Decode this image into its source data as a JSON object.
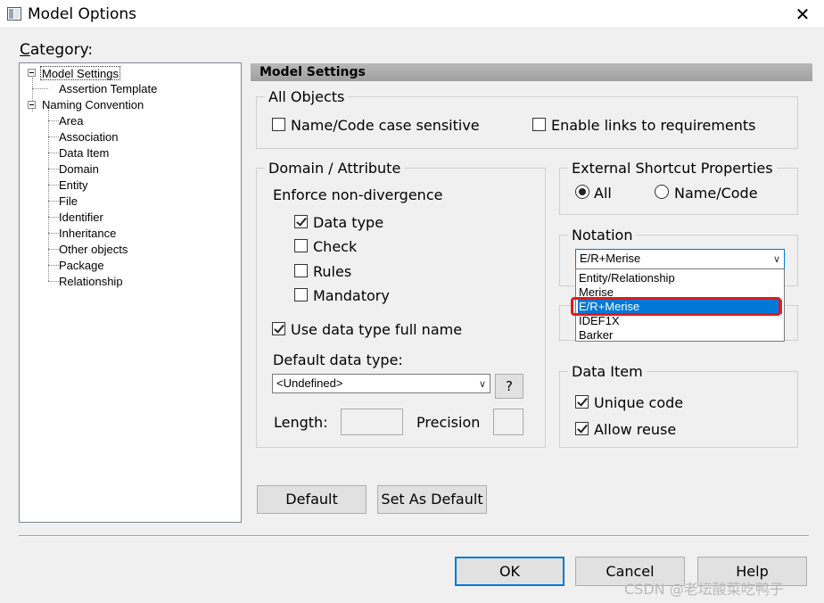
{
  "window": {
    "title": "Model Options",
    "close_glyph": "✕"
  },
  "category": {
    "label": "Category:",
    "tree": [
      "Model Settings",
      "Assertion Template",
      "Naming Convention",
      "Area",
      "Association",
      "Data Item",
      "Domain",
      "Entity",
      "File",
      "Identifier",
      "Inheritance",
      "Other objects",
      "Package",
      "Relationship"
    ]
  },
  "panel": {
    "header": "Model Settings"
  },
  "all_objects": {
    "title": "All Objects",
    "name_code_case_sensitive": "Name/Code case sensitive",
    "enable_links": "Enable links to requirements"
  },
  "domain_attribute": {
    "title": "Domain / Attribute",
    "enforce": "Enforce non-divergence",
    "data_type": "Data type",
    "check": "Check",
    "rules": "Rules",
    "mandatory": "Mandatory",
    "use_full_name": "Use data type full name",
    "default_type_label": "Default data type:",
    "default_type_value": "<Undefined>",
    "help_glyph": "?",
    "length_label": "Length:",
    "precision_label": "Precision"
  },
  "external_shortcut": {
    "title": "External Shortcut Properties",
    "all": "All",
    "name_code": "Name/Code",
    "selected": "All"
  },
  "notation": {
    "title": "Notation",
    "value": "E/R+Merise",
    "options": [
      "Entity/Relationship",
      "Merise",
      "E/R+Merise",
      "IDEF1X",
      "Barker"
    ],
    "selected_index": 2
  },
  "data_item": {
    "title": "Data Item",
    "unique_code": "Unique code",
    "allow_reuse": "Allow reuse"
  },
  "buttons": {
    "default": "Default",
    "set_as_default": "Set As Default",
    "ok": "OK",
    "cancel": "Cancel",
    "help": "Help"
  },
  "watermark": "CSDN @老坛酸菜吃鸭子"
}
